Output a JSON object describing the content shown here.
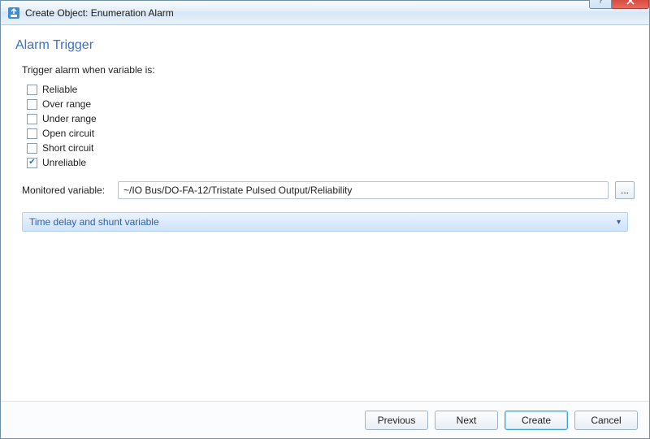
{
  "window": {
    "title": "Create Object: Enumeration Alarm"
  },
  "page": {
    "heading": "Alarm Trigger"
  },
  "trigger": {
    "label": "Trigger alarm when variable is:",
    "options": [
      {
        "label": "Reliable",
        "checked": false
      },
      {
        "label": "Over range",
        "checked": false
      },
      {
        "label": "Under range",
        "checked": false
      },
      {
        "label": "Open circuit",
        "checked": false
      },
      {
        "label": "Short circuit",
        "checked": false
      },
      {
        "label": "Unreliable",
        "checked": true
      }
    ]
  },
  "monitored": {
    "label": "Monitored variable:",
    "value": "~/IO Bus/DO-FA-12/Tristate Pulsed Output/Reliability",
    "browse": "..."
  },
  "expander": {
    "label": "Time delay and shunt variable"
  },
  "buttons": {
    "previous": "Previous",
    "next": "Next",
    "create": "Create",
    "cancel": "Cancel",
    "help": "?"
  }
}
